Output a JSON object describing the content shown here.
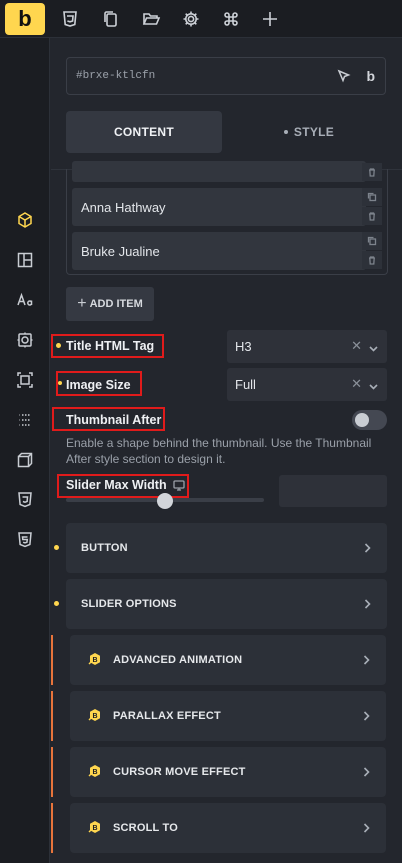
{
  "app": {
    "logo_letter": "b"
  },
  "toolbar": {
    "icons": [
      "css3-icon",
      "copy-icon",
      "folder-open-icon",
      "gear-icon",
      "command-icon",
      "plus-icon"
    ]
  },
  "rail": {
    "icons": [
      "cube-icon",
      "layout-icon",
      "typography-icon",
      "component-icon",
      "frame-icon",
      "grid-dots-icon",
      "box-3d-icon",
      "css3-icon",
      "html5-icon"
    ],
    "active": "cube-icon"
  },
  "element": {
    "id": "#brxe-ktlcfn",
    "badge_letter": "b"
  },
  "tabs": {
    "content": "CONTENT",
    "style": "STYLE",
    "active": "content"
  },
  "items": [
    {
      "label": "Anna Hathway"
    },
    {
      "label": "Bruke Jualine"
    }
  ],
  "add_item_label": "ADD ITEM",
  "controls": {
    "title_tag": {
      "label": "Title HTML Tag",
      "value": "H3"
    },
    "image_size": {
      "label": "Image Size",
      "value": "Full"
    },
    "thumbnail_after": {
      "label": "Thumbnail After",
      "enabled": false,
      "description": "Enable a shape behind the thumbnail. Use the Thumbnail After style section to design it."
    },
    "slider_max_width": {
      "label": "Slider Max Width",
      "value": ""
    }
  },
  "sections": [
    {
      "label": "BUTTON",
      "modified": true
    },
    {
      "label": "SLIDER OPTIONS",
      "modified": true
    }
  ],
  "addon_sections": [
    {
      "label": "ADVANCED ANIMATION"
    },
    {
      "label": "PARALLAX EFFECT"
    },
    {
      "label": "CURSOR MOVE EFFECT"
    },
    {
      "label": "SCROLL TO"
    }
  ],
  "colors": {
    "accent": "#ffd64f",
    "highlight": "#e01b1b",
    "addon_bar": "#e8743b"
  }
}
